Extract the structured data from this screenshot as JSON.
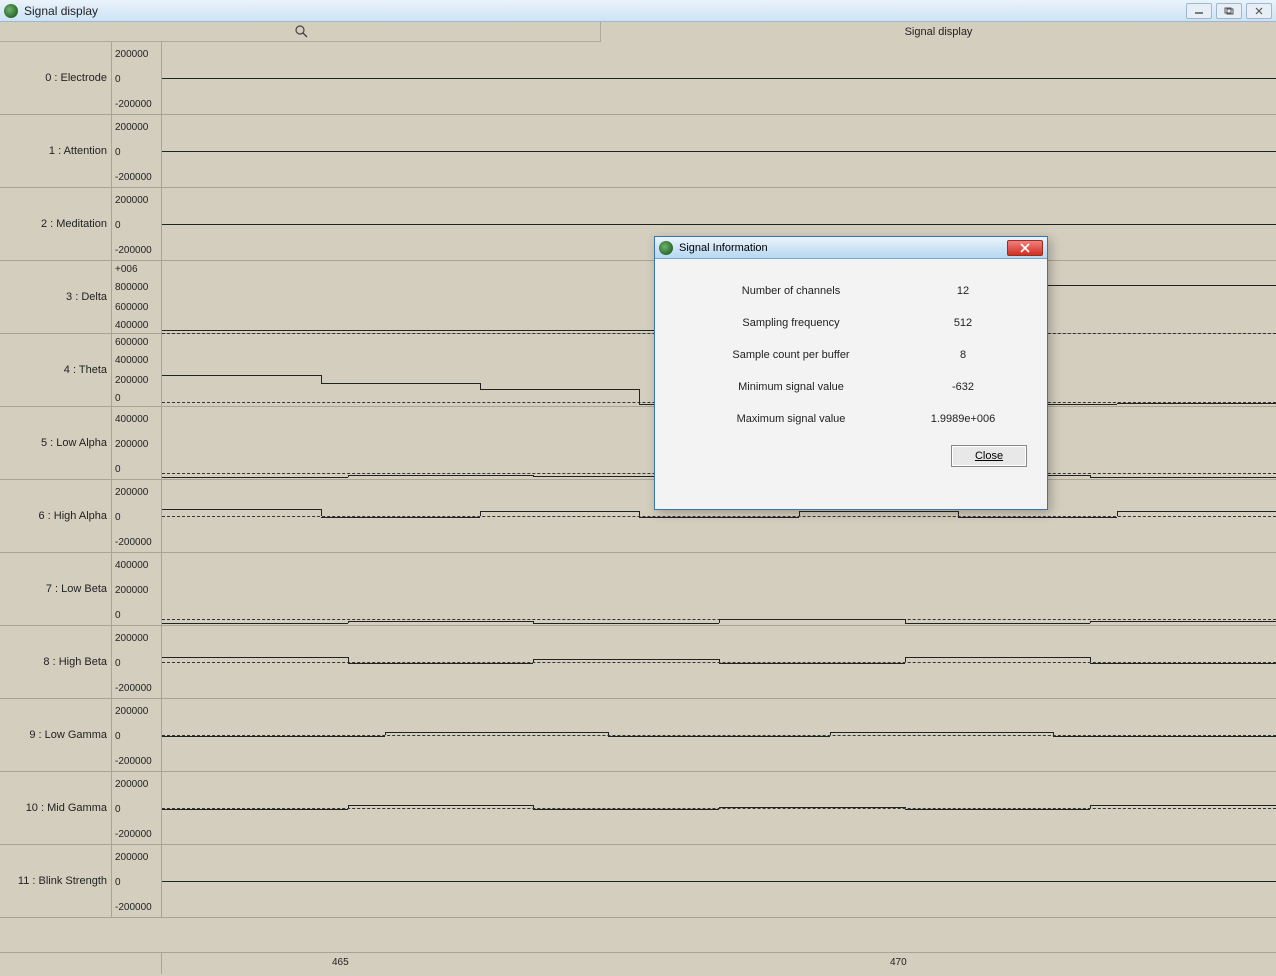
{
  "window": {
    "title": "Signal display",
    "header_label": "Signal display"
  },
  "dialog": {
    "title": "Signal Information",
    "rows": [
      {
        "label": "Number of channels",
        "value": "12"
      },
      {
        "label": "Sampling frequency",
        "value": "512"
      },
      {
        "label": "Sample count per buffer",
        "value": "8"
      },
      {
        "label": "Minimum signal value",
        "value": "-632"
      },
      {
        "label": "Maximum signal value",
        "value": "1.9989e+006"
      }
    ],
    "close_label": "Close"
  },
  "xaxis": {
    "ticks": [
      "465",
      "470"
    ]
  },
  "channels": [
    {
      "label": "0 : Electrode",
      "yTicks": [
        "200000",
        "0",
        "-200000"
      ]
    },
    {
      "label": "1 : Attention",
      "yTicks": [
        "200000",
        "0",
        "-200000"
      ]
    },
    {
      "label": "2 : Meditation",
      "yTicks": [
        "200000",
        "0",
        "-200000"
      ]
    },
    {
      "label": "3 : Delta",
      "yTicks": [
        "+006",
        "800000",
        "600000",
        "400000"
      ]
    },
    {
      "label": "4 : Theta",
      "yTicks": [
        "600000",
        "400000",
        "200000",
        "0"
      ]
    },
    {
      "label": "5 : Low Alpha",
      "yTicks": [
        "400000",
        "200000",
        "0"
      ]
    },
    {
      "label": "6 : High Alpha",
      "yTicks": [
        "200000",
        "0",
        "-200000"
      ]
    },
    {
      "label": "7 : Low Beta",
      "yTicks": [
        "400000",
        "200000",
        "0"
      ]
    },
    {
      "label": "8 : High Beta",
      "yTicks": [
        "200000",
        "0",
        "-200000"
      ]
    },
    {
      "label": "9 : Low Gamma",
      "yTicks": [
        "200000",
        "0",
        "-200000"
      ]
    },
    {
      "label": "10 : Mid Gamma",
      "yTicks": [
        "200000",
        "0",
        "-200000"
      ]
    },
    {
      "label": "11 : Blink Strength",
      "yTicks": [
        "200000",
        "0",
        "-200000"
      ]
    }
  ],
  "chart_data": {
    "type": "line",
    "x_range": [
      463,
      473
    ],
    "xlabel": "",
    "ylabel": "",
    "title": "Signal display",
    "channels": [
      {
        "name": "0 : Electrode",
        "y_range": [
          -200000,
          200000
        ],
        "approx_level": 0,
        "style": "noisy"
      },
      {
        "name": "1 : Attention",
        "y_range": [
          -200000,
          200000
        ],
        "approx_level": 0,
        "style": "flat"
      },
      {
        "name": "2 : Meditation",
        "y_range": [
          -200000,
          200000
        ],
        "approx_level": 0,
        "style": "flat"
      },
      {
        "name": "3 : Delta",
        "y_range": [
          400000,
          1000000
        ],
        "steps": [
          430000,
          430000,
          800000
        ],
        "style": "step"
      },
      {
        "name": "4 : Theta",
        "y_range": [
          0,
          600000
        ],
        "steps": [
          260000,
          200000,
          150000,
          20000,
          300000,
          0,
          30000
        ],
        "style": "step"
      },
      {
        "name": "5 : Low Alpha",
        "y_range": [
          0,
          400000
        ],
        "steps": [
          0,
          30000,
          20000,
          0,
          30000,
          0
        ],
        "style": "step"
      },
      {
        "name": "6 : High Alpha",
        "y_range": [
          -200000,
          200000
        ],
        "steps": [
          40000,
          0,
          30000,
          0,
          30000,
          0,
          30000
        ],
        "style": "step"
      },
      {
        "name": "7 : Low Beta",
        "y_range": [
          0,
          400000
        ],
        "steps": [
          0,
          30000,
          0,
          40000,
          0,
          30000
        ],
        "style": "step"
      },
      {
        "name": "8 : High Beta",
        "y_range": [
          -200000,
          200000
        ],
        "steps": [
          30000,
          0,
          20000,
          0,
          30000,
          0
        ],
        "style": "step"
      },
      {
        "name": "9 : Low Gamma",
        "y_range": [
          -200000,
          200000
        ],
        "steps": [
          0,
          20000,
          0,
          20000,
          0
        ],
        "style": "step"
      },
      {
        "name": "10 : Mid Gamma",
        "y_range": [
          -200000,
          200000
        ],
        "steps": [
          0,
          20000,
          0,
          10000,
          0,
          20000
        ],
        "style": "step"
      },
      {
        "name": "11 : Blink Strength",
        "y_range": [
          -200000,
          200000
        ],
        "approx_level": 0,
        "style": "flat"
      }
    ]
  }
}
